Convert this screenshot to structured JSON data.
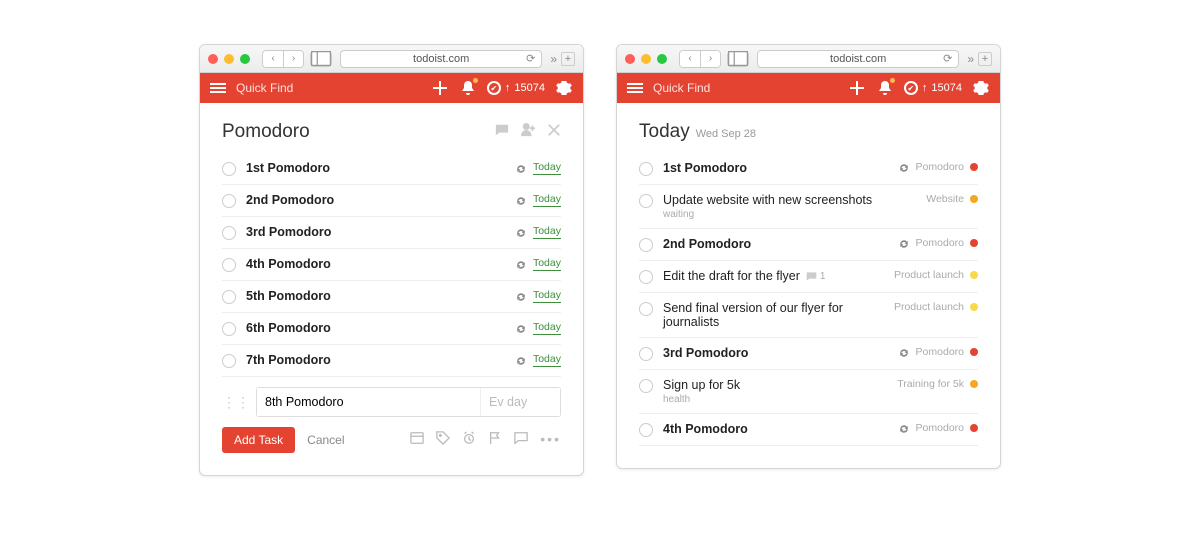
{
  "chrome": {
    "url": "todoist.com"
  },
  "header": {
    "search_placeholder": "Quick Find",
    "karma_arrow": "↑",
    "karma_score": "15074"
  },
  "left": {
    "title": "Pomodoro",
    "tasks": [
      {
        "title": "1st Pomodoro",
        "date": "Today"
      },
      {
        "title": "2nd Pomodoro",
        "date": "Today"
      },
      {
        "title": "3rd Pomodoro",
        "date": "Today"
      },
      {
        "title": "4th Pomodoro",
        "date": "Today"
      },
      {
        "title": "5th Pomodoro",
        "date": "Today"
      },
      {
        "title": "6th Pomodoro",
        "date": "Today"
      },
      {
        "title": "7th Pomodoro",
        "date": "Today"
      }
    ],
    "editor": {
      "value": "8th Pomodoro",
      "date_placeholder": "Ev day",
      "add_label": "Add Task",
      "cancel_label": "Cancel"
    }
  },
  "right": {
    "title": "Today",
    "subtitle": "Wed Sep 28",
    "tasks": [
      {
        "title": "1st Pomodoro",
        "bold": true,
        "recur": true,
        "project": "Pomodoro",
        "color": "c-red"
      },
      {
        "title": "Update website with new screenshots",
        "sub": "waiting",
        "project": "Website",
        "color": "c-orange"
      },
      {
        "title": "2nd Pomodoro",
        "bold": true,
        "recur": true,
        "project": "Pomodoro",
        "color": "c-red"
      },
      {
        "title": "Edit the draft for the flyer",
        "comments": "1",
        "project": "Product launch",
        "color": "c-yellow"
      },
      {
        "title": "Send final version of our flyer for journalists",
        "project": "Product launch",
        "color": "c-yellow"
      },
      {
        "title": "3rd Pomodoro",
        "bold": true,
        "recur": true,
        "project": "Pomodoro",
        "color": "c-red"
      },
      {
        "title": "Sign up for 5k",
        "sub": "health",
        "project": "Training for 5k",
        "color": "c-orange"
      },
      {
        "title": "4th Pomodoro",
        "bold": true,
        "recur": true,
        "project": "Pomodoro",
        "color": "c-red"
      }
    ]
  }
}
